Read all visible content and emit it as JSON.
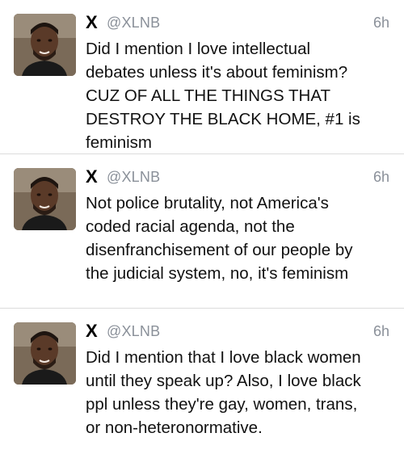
{
  "colors": {
    "handle_gray": "#8a9099",
    "divider": "#dcdcdc",
    "text": "#111111"
  },
  "tweets": [
    {
      "display_name": "X",
      "handle": "@XLNB",
      "time": "6h",
      "avatar_icon": "profile-photo",
      "text": "Did I mention I love intellectual\ndebates unless it's about feminism?\nCUZ OF ALL THE THINGS THAT\nDESTROY THE BLACK HOME, #1 is\nfeminism"
    },
    {
      "display_name": "X",
      "handle": "@XLNB",
      "time": "6h",
      "avatar_icon": "profile-photo",
      "text": "Not police brutality, not America's\ncoded racial agenda, not the\ndisenfranchisement of our people by\nthe judicial system, no, it's feminism"
    },
    {
      "display_name": "X",
      "handle": "@XLNB",
      "time": "6h",
      "avatar_icon": "profile-photo",
      "text": "Did I mention that I love black women\nuntil they speak up? Also, I love black\nppl unless they're gay, women, trans,\nor non-heteronormative."
    }
  ]
}
